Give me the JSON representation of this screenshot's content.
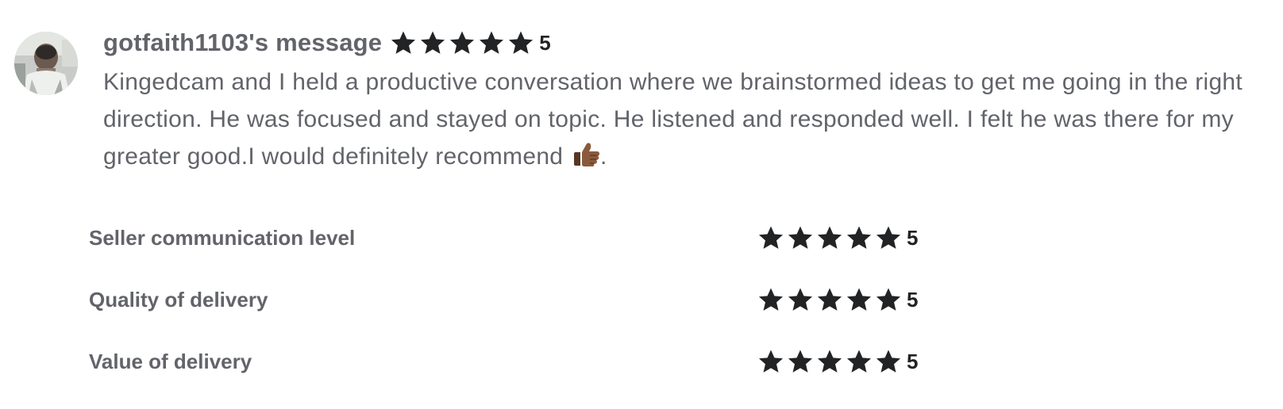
{
  "review": {
    "reviewer_name": "gotfaith1103's message",
    "rating": {
      "stars": 5,
      "value": "5"
    },
    "message": "Kingedcam and I held a productive conversation where we brainstormed ideas to get me going in the right direction. He was focused and stayed on topic. He listened and responded well. I felt he was there for my greater good.I would definitely recommend",
    "message_end": ".",
    "icons": {
      "avatar": "user-photo",
      "star": "star-icon",
      "emoji": "thumbs-up-icon"
    },
    "colors": {
      "text": "#62646a",
      "star": "#222325"
    }
  },
  "breakdown": [
    {
      "label": "Seller communication level",
      "stars": 5,
      "value": "5"
    },
    {
      "label": "Quality of delivery",
      "stars": 5,
      "value": "5"
    },
    {
      "label": "Value of delivery",
      "stars": 5,
      "value": "5"
    }
  ]
}
